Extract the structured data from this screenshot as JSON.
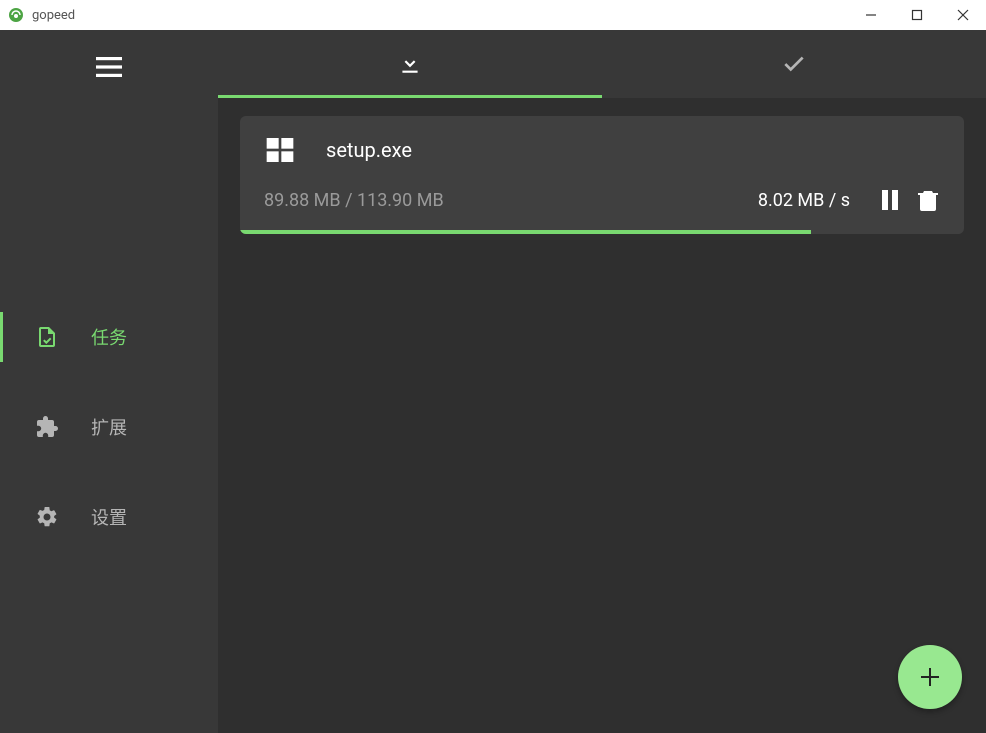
{
  "window": {
    "title": "gopeed"
  },
  "sidebar": {
    "items": [
      {
        "label": "任务",
        "icon": "file-check",
        "active": true
      },
      {
        "label": "扩展",
        "icon": "extension",
        "active": false
      },
      {
        "label": "设置",
        "icon": "gear",
        "active": false
      }
    ]
  },
  "tabs": [
    {
      "icon": "download",
      "active": true
    },
    {
      "icon": "check",
      "active": false
    }
  ],
  "downloads": [
    {
      "file_name": "setup.exe",
      "file_type": "windows",
      "progress_text": "89.88 MB / 113.90 MB",
      "speed_text": "8.02 MB / s",
      "progress_percent": 78.9
    }
  ],
  "colors": {
    "accent": "#79d970",
    "fab": "#98e890",
    "sidebar_bg": "#383838",
    "main_bg": "#2f2f2f",
    "card_bg": "#404040"
  }
}
